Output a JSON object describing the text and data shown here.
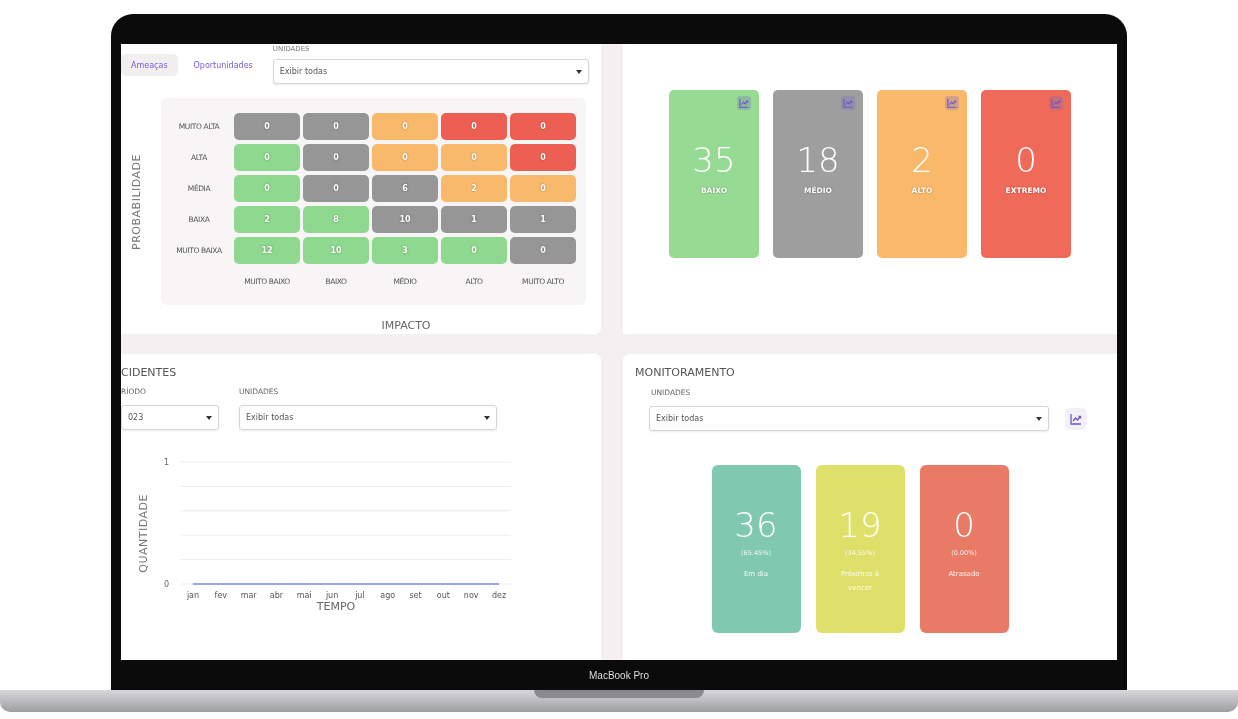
{
  "device_label": "MacBook Pro",
  "risk_panel": {
    "tabs": [
      {
        "label": "Ameaças",
        "selected": true
      },
      {
        "label": "Oportunidades",
        "selected": false
      }
    ],
    "units_label": "UNIDADES",
    "units_select": {
      "value": "Exibir todas"
    },
    "y_axis_title": "PROBABILIDADE",
    "x_axis_title": "IMPACTO",
    "probability_levels": [
      {
        "label": "MUITO ALTA",
        "cells": [
          {
            "value": "0",
            "color": "#969696"
          },
          {
            "value": "0",
            "color": "#969696"
          },
          {
            "value": "0",
            "color": "#f9b96a"
          },
          {
            "value": "0",
            "color": "#ee5f53"
          },
          {
            "value": "0",
            "color": "#ee5f53"
          }
        ]
      },
      {
        "label": "ALTA",
        "cells": [
          {
            "value": "0",
            "color": "#8fd88f"
          },
          {
            "value": "0",
            "color": "#969696"
          },
          {
            "value": "0",
            "color": "#f9b96a"
          },
          {
            "value": "0",
            "color": "#f9b96a"
          },
          {
            "value": "0",
            "color": "#ee5f53"
          }
        ]
      },
      {
        "label": "MÉDIA",
        "cells": [
          {
            "value": "0",
            "color": "#8fd88f"
          },
          {
            "value": "0",
            "color": "#969696"
          },
          {
            "value": "6",
            "color": "#969696"
          },
          {
            "value": "2",
            "color": "#f9b96a"
          },
          {
            "value": "0",
            "color": "#f9b96a"
          }
        ]
      },
      {
        "label": "BAIXA",
        "cells": [
          {
            "value": "2",
            "color": "#8fd88f"
          },
          {
            "value": "8",
            "color": "#8fd88f"
          },
          {
            "value": "10",
            "color": "#969696"
          },
          {
            "value": "1",
            "color": "#969696"
          },
          {
            "value": "1",
            "color": "#969696"
          }
        ]
      },
      {
        "label": "MUITO BAIXA",
        "cells": [
          {
            "value": "12",
            "color": "#8fd88f"
          },
          {
            "value": "10",
            "color": "#8fd88f"
          },
          {
            "value": "3",
            "color": "#8fd88f"
          },
          {
            "value": "0",
            "color": "#8fd88f"
          },
          {
            "value": "0",
            "color": "#969696"
          }
        ]
      }
    ],
    "impact_levels": [
      "MUITO BAIXO",
      "BAIXO",
      "MÉDIO",
      "ALTO",
      "MUITO ALTO"
    ]
  },
  "level_cards": [
    {
      "value": "35",
      "label": "BAIXO",
      "color": "#97da94"
    },
    {
      "value": "18",
      "label": "MÉDIO",
      "color": "#9e9e9e"
    },
    {
      "value": "2",
      "label": "ALTO",
      "color": "#fab86a"
    },
    {
      "value": "0",
      "label": "EXTREMO",
      "color": "#f06a5a"
    }
  ],
  "incidents_panel": {
    "title": "CIDENTES",
    "period_label": "RÍODO",
    "period_select": {
      "value": "023"
    },
    "units_label": "UNIDADES",
    "units_select": {
      "value": "Exibir todas"
    },
    "chart_data": {
      "type": "line",
      "xlabel": "TEMPO",
      "ylabel": "QUANTIDADE",
      "categories": [
        "jan",
        "fev",
        "mar",
        "abr",
        "mai",
        "jun",
        "jul",
        "ago",
        "set",
        "out",
        "nov",
        "dez"
      ],
      "ylim": [
        0,
        1
      ],
      "yticks": [
        0,
        1
      ],
      "series": [
        {
          "color": "#7b8cd6",
          "values": [
            0,
            0,
            0,
            0,
            0,
            0,
            0,
            0,
            0,
            0,
            0,
            0
          ]
        }
      ]
    }
  },
  "monitoring_panel": {
    "title": "MONITORAMENTO",
    "units_label": "UNIDADES",
    "units_select": {
      "value": "Exibir todas"
    },
    "cards": [
      {
        "value": "36",
        "percent": "(65.45%)",
        "label": "Em dia",
        "color": "#80c9b0"
      },
      {
        "value": "19",
        "percent": "(34.55%)",
        "label": "Próximos à vencer",
        "color": "#dfe06a"
      },
      {
        "value": "0",
        "percent": "(0.00%)",
        "label": "Atrasado",
        "color": "#e97a66"
      }
    ]
  }
}
